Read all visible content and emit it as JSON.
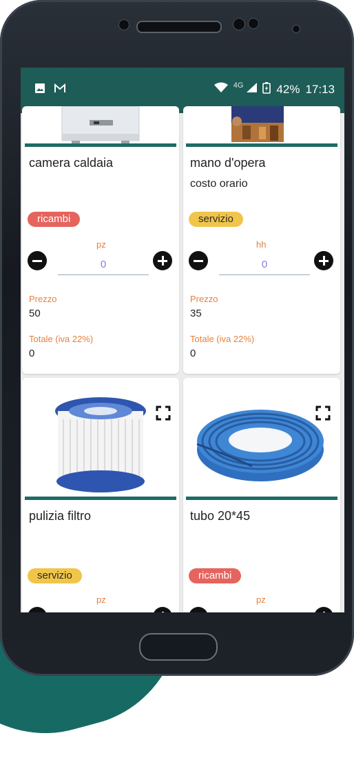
{
  "statusbar": {
    "network": "4G",
    "battery": "42%",
    "time": "17:13",
    "left_icons": [
      "image-icon",
      "gmail-icon"
    ]
  },
  "products": [
    {
      "title": "camera caldaia",
      "subtitle": "",
      "tag": "ricambi",
      "unit": "pz",
      "quantity": "0",
      "price_label": "Prezzo",
      "price": "50",
      "total_label": "Totale (iva 22%)",
      "total": "0"
    },
    {
      "title": "mano d'opera",
      "subtitle": "costo orario",
      "tag": "servizio",
      "unit": "hh",
      "quantity": "0",
      "price_label": "Prezzo",
      "price": "35",
      "total_label": "Totale (iva 22%)",
      "total": "0"
    },
    {
      "title": "pulizia filtro",
      "subtitle": "",
      "tag": "servizio",
      "unit": "pz"
    },
    {
      "title": "tubo 20*45",
      "subtitle": "",
      "tag": "ricambi",
      "unit": "pz"
    }
  ],
  "colors": {
    "statusbar": "#1e5c57",
    "divider": "#1f6b66",
    "tag_ricambi": "#e5645e",
    "tag_servizio": "#f0c54a",
    "label_orange": "#e77f3b",
    "quantity_text": "#8a7bd6"
  }
}
